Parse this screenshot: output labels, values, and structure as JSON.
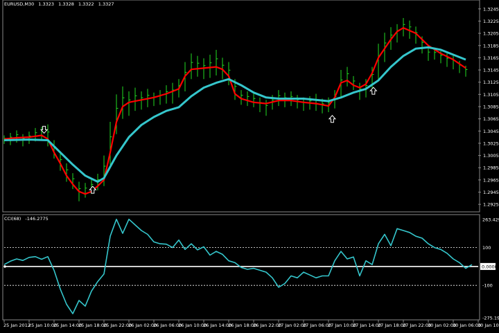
{
  "chart_data": [
    {
      "type": "line",
      "symbol": "EURUSD,M30",
      "quote": [
        "1.3323",
        "1.3328",
        "1.3322",
        "1.3327"
      ],
      "ylim": [
        1.2915,
        1.3255
      ],
      "y_ticks": [
        "1.3245",
        "1.3225",
        "1.3205",
        "1.3185",
        "1.3165",
        "1.3145",
        "1.3125",
        "1.3105",
        "1.3085",
        "1.3065",
        "1.3045",
        "1.3025",
        "1.3005",
        "1.2985",
        "1.2965",
        "1.2945",
        "1.2925"
      ],
      "x_ticks": [
        "25 Jan 2012",
        "25 Jan 10:00",
        "25 Jan 14:00",
        "25 Jan 18:00",
        "25 Jan 22:00",
        "26 Jan 02:00",
        "26 Jan 06:00",
        "26 Jan 10:00",
        "26 Jan 14:00",
        "26 Jan 18:00",
        "26 Jan 22:00",
        "27 Jan 02:00",
        "27 Jan 06:00",
        "27 Jan 10:00",
        "27 Jan 14:00",
        "27 Jan 18:00",
        "27 Jan 22:00",
        "30 Jan 02:00",
        "30 Jan 06:00",
        "30 Jan 10:00"
      ],
      "bars": [
        {
          "x": 0.0,
          "h": 1.3038,
          "l": 1.3024
        },
        {
          "x": 0.25,
          "h": 1.3042,
          "l": 1.3022
        },
        {
          "x": 0.5,
          "h": 1.3046,
          "l": 1.3026
        },
        {
          "x": 0.75,
          "h": 1.304,
          "l": 1.302
        },
        {
          "x": 1.0,
          "h": 1.3044,
          "l": 1.3024
        },
        {
          "x": 1.25,
          "h": 1.305,
          "l": 1.3028
        },
        {
          "x": 1.5,
          "h": 1.3052,
          "l": 1.303
        },
        {
          "x": 1.75,
          "h": 1.3056,
          "l": 1.302
        },
        {
          "x": 2.0,
          "h": 1.303,
          "l": 1.3
        },
        {
          "x": 2.25,
          "h": 1.3008,
          "l": 1.298
        },
        {
          "x": 2.5,
          "h": 1.2992,
          "l": 1.2962
        },
        {
          "x": 2.75,
          "h": 1.2976,
          "l": 1.295
        },
        {
          "x": 3.0,
          "h": 1.2962,
          "l": 1.293
        },
        {
          "x": 3.25,
          "h": 1.296,
          "l": 1.2936
        },
        {
          "x": 3.5,
          "h": 1.2966,
          "l": 1.2942
        },
        {
          "x": 3.75,
          "h": 1.2975,
          "l": 1.2948
        },
        {
          "x": 4.0,
          "h": 1.3005,
          "l": 1.2955
        },
        {
          "x": 4.25,
          "h": 1.306,
          "l": 1.299
        },
        {
          "x": 4.5,
          "h": 1.3105,
          "l": 1.304
        },
        {
          "x": 4.75,
          "h": 1.3118,
          "l": 1.3065
        },
        {
          "x": 5.0,
          "h": 1.311,
          "l": 1.307
        },
        {
          "x": 5.25,
          "h": 1.3116,
          "l": 1.3078
        },
        {
          "x": 5.5,
          "h": 1.311,
          "l": 1.308
        },
        {
          "x": 5.75,
          "h": 1.3114,
          "l": 1.3084
        },
        {
          "x": 6.0,
          "h": 1.3108,
          "l": 1.3086
        },
        {
          "x": 6.25,
          "h": 1.3112,
          "l": 1.3088
        },
        {
          "x": 6.5,
          "h": 1.312,
          "l": 1.309
        },
        {
          "x": 6.75,
          "h": 1.3124,
          "l": 1.309
        },
        {
          "x": 7.0,
          "h": 1.313,
          "l": 1.31
        },
        {
          "x": 7.25,
          "h": 1.3158,
          "l": 1.311
        },
        {
          "x": 7.5,
          "h": 1.3172,
          "l": 1.313
        },
        {
          "x": 7.75,
          "h": 1.3168,
          "l": 1.3134
        },
        {
          "x": 8.0,
          "h": 1.3164,
          "l": 1.313
        },
        {
          "x": 8.25,
          "h": 1.317,
          "l": 1.3132
        },
        {
          "x": 8.5,
          "h": 1.3178,
          "l": 1.3136
        },
        {
          "x": 8.75,
          "h": 1.3165,
          "l": 1.313
        },
        {
          "x": 9.0,
          "h": 1.3158,
          "l": 1.312
        },
        {
          "x": 9.25,
          "h": 1.313,
          "l": 1.3096
        },
        {
          "x": 9.5,
          "h": 1.3112,
          "l": 1.3088
        },
        {
          "x": 9.75,
          "h": 1.311,
          "l": 1.3086
        },
        {
          "x": 10.0,
          "h": 1.3106,
          "l": 1.3084
        },
        {
          "x": 10.25,
          "h": 1.31,
          "l": 1.3076
        },
        {
          "x": 10.5,
          "h": 1.3096,
          "l": 1.307
        },
        {
          "x": 10.75,
          "h": 1.3104,
          "l": 1.308
        },
        {
          "x": 11.0,
          "h": 1.3112,
          "l": 1.3086
        },
        {
          "x": 11.25,
          "h": 1.3108,
          "l": 1.3084
        },
        {
          "x": 11.5,
          "h": 1.311,
          "l": 1.3086
        },
        {
          "x": 11.75,
          "h": 1.3104,
          "l": 1.3082
        },
        {
          "x": 12.0,
          "h": 1.31,
          "l": 1.3078
        },
        {
          "x": 12.25,
          "h": 1.3102,
          "l": 1.308
        },
        {
          "x": 12.5,
          "h": 1.3106,
          "l": 1.3078
        },
        {
          "x": 12.75,
          "h": 1.3098,
          "l": 1.3074
        },
        {
          "x": 13.0,
          "h": 1.31,
          "l": 1.3076
        },
        {
          "x": 13.25,
          "h": 1.3112,
          "l": 1.3082
        },
        {
          "x": 13.5,
          "h": 1.3145,
          "l": 1.3098
        },
        {
          "x": 13.75,
          "h": 1.315,
          "l": 1.3118
        },
        {
          "x": 14.0,
          "h": 1.3135,
          "l": 1.3112
        },
        {
          "x": 14.25,
          "h": 1.3124,
          "l": 1.3096
        },
        {
          "x": 14.5,
          "h": 1.313,
          "l": 1.31
        },
        {
          "x": 14.75,
          "h": 1.315,
          "l": 1.3115
        },
        {
          "x": 15.0,
          "h": 1.3188,
          "l": 1.313
        },
        {
          "x": 15.25,
          "h": 1.3206,
          "l": 1.3158
        },
        {
          "x": 15.5,
          "h": 1.3215,
          "l": 1.3178
        },
        {
          "x": 15.75,
          "h": 1.322,
          "l": 1.319
        },
        {
          "x": 16.0,
          "h": 1.323,
          "l": 1.32
        },
        {
          "x": 16.25,
          "h": 1.3226,
          "l": 1.3196
        },
        {
          "x": 16.5,
          "h": 1.3216,
          "l": 1.3188
        },
        {
          "x": 16.75,
          "h": 1.32,
          "l": 1.3172
        },
        {
          "x": 17.0,
          "h": 1.3182,
          "l": 1.316
        },
        {
          "x": 17.25,
          "h": 1.318,
          "l": 1.3162
        },
        {
          "x": 17.5,
          "h": 1.3176,
          "l": 1.3156
        },
        {
          "x": 17.75,
          "h": 1.3172,
          "l": 1.315
        },
        {
          "x": 18.0,
          "h": 1.3168,
          "l": 1.3146
        },
        {
          "x": 18.25,
          "h": 1.316,
          "l": 1.314
        },
        {
          "x": 18.5,
          "h": 1.3152,
          "l": 1.3134
        }
      ],
      "series": [
        {
          "name": "",
          "color": "#ff0000",
          "points": [
            [
              0,
              1.3032
            ],
            [
              0.5,
              1.3034
            ],
            [
              1,
              1.3035
            ],
            [
              1.5,
              1.3038
            ],
            [
              1.75,
              1.3032
            ],
            [
              2,
              1.301
            ],
            [
              2.25,
              1.2992
            ],
            [
              2.5,
              1.2972
            ],
            [
              2.75,
              1.2958
            ],
            [
              3,
              1.2946
            ],
            [
              3.25,
              1.2942
            ],
            [
              3.5,
              1.2946
            ],
            [
              3.75,
              1.2955
            ],
            [
              4,
              1.2965
            ],
            [
              4.25,
              1.301
            ],
            [
              4.5,
              1.306
            ],
            [
              4.75,
              1.3085
            ],
            [
              5,
              1.3092
            ],
            [
              5.5,
              1.3096
            ],
            [
              6,
              1.31
            ],
            [
              6.5,
              1.3106
            ],
            [
              7,
              1.3114
            ],
            [
              7.25,
              1.3135
            ],
            [
              7.5,
              1.3146
            ],
            [
              8,
              1.3148
            ],
            [
              8.5,
              1.315
            ],
            [
              8.75,
              1.3146
            ],
            [
              9,
              1.3135
            ],
            [
              9.25,
              1.3106
            ],
            [
              9.5,
              1.3098
            ],
            [
              10,
              1.3092
            ],
            [
              10.5,
              1.309
            ],
            [
              11,
              1.3095
            ],
            [
              11.5,
              1.3095
            ],
            [
              12,
              1.3092
            ],
            [
              12.5,
              1.309
            ],
            [
              13,
              1.3086
            ],
            [
              13.25,
              1.31
            ],
            [
              13.5,
              1.3124
            ],
            [
              13.75,
              1.3128
            ],
            [
              14,
              1.312
            ],
            [
              14.25,
              1.3116
            ],
            [
              14.5,
              1.3122
            ],
            [
              14.75,
              1.314
            ],
            [
              15,
              1.3165
            ],
            [
              15.5,
              1.3195
            ],
            [
              15.75,
              1.3208
            ],
            [
              16,
              1.3214
            ],
            [
              16.5,
              1.3205
            ],
            [
              17,
              1.3185
            ],
            [
              17.5,
              1.3172
            ],
            [
              18,
              1.3162
            ],
            [
              18.5,
              1.3148
            ]
          ]
        },
        {
          "name": "",
          "color": "#35c6cc",
          "points": [
            [
              0,
              1.303
            ],
            [
              1,
              1.3031
            ],
            [
              1.75,
              1.303
            ],
            [
              2.25,
              1.301
            ],
            [
              2.75,
              1.299
            ],
            [
              3.25,
              1.2972
            ],
            [
              3.75,
              1.2962
            ],
            [
              4,
              1.2968
            ],
            [
              4.5,
              1.3005
            ],
            [
              5,
              1.3035
            ],
            [
              5.5,
              1.3055
            ],
            [
              6,
              1.3068
            ],
            [
              6.5,
              1.3078
            ],
            [
              7,
              1.3084
            ],
            [
              7.5,
              1.3102
            ],
            [
              8,
              1.3116
            ],
            [
              8.5,
              1.3124
            ],
            [
              9,
              1.313
            ],
            [
              9.5,
              1.312
            ],
            [
              10,
              1.3108
            ],
            [
              10.5,
              1.31
            ],
            [
              11,
              1.3098
            ],
            [
              11.5,
              1.3098
            ],
            [
              12,
              1.3098
            ],
            [
              12.5,
              1.3096
            ],
            [
              13,
              1.3094
            ],
            [
              13.5,
              1.31
            ],
            [
              14,
              1.3108
            ],
            [
              14.5,
              1.3114
            ],
            [
              15,
              1.3128
            ],
            [
              15.5,
              1.315
            ],
            [
              16,
              1.3168
            ],
            [
              16.5,
              1.318
            ],
            [
              17,
              1.3182
            ],
            [
              17.5,
              1.3178
            ],
            [
              18,
              1.317
            ],
            [
              18.5,
              1.3162
            ]
          ]
        }
      ],
      "arrows": [
        {
          "x": 1.6,
          "y": 1.3046,
          "dir": "down"
        },
        {
          "x": 3.55,
          "y": 1.295,
          "dir": "up"
        },
        {
          "x": 13.15,
          "y": 1.3066,
          "dir": "up"
        },
        {
          "x": 14.8,
          "y": 1.3112,
          "dir": "up"
        }
      ]
    },
    {
      "type": "line",
      "indicator": "CCI(68)",
      "value": "-146.2775",
      "ylim": [
        -275.197,
        263.429
      ],
      "y_ticks": [
        "263.429",
        "100",
        "0.0000",
        "-100",
        "-275.197"
      ],
      "levels": [
        100,
        -100
      ],
      "zero_label": "0.0000",
      "series": [
        {
          "name": "",
          "color": "#35c6cc",
          "points": [
            [
              0,
              10
            ],
            [
              0.25,
              28
            ],
            [
              0.5,
              40
            ],
            [
              0.75,
              32
            ],
            [
              1,
              48
            ],
            [
              1.25,
              52
            ],
            [
              1.5,
              38
            ],
            [
              1.75,
              52
            ],
            [
              2,
              -20
            ],
            [
              2.25,
              -120
            ],
            [
              2.5,
              -200
            ],
            [
              2.75,
              -250
            ],
            [
              3,
              -180
            ],
            [
              3.25,
              -210
            ],
            [
              3.5,
              -130
            ],
            [
              3.75,
              -80
            ],
            [
              4,
              -40
            ],
            [
              4.25,
              160
            ],
            [
              4.5,
              250
            ],
            [
              4.75,
              175
            ],
            [
              5,
              250
            ],
            [
              5.25,
              220
            ],
            [
              5.5,
              190
            ],
            [
              5.75,
              170
            ],
            [
              6,
              130
            ],
            [
              6.25,
              120
            ],
            [
              6.5,
              118
            ],
            [
              6.75,
              100
            ],
            [
              7,
              140
            ],
            [
              7.25,
              90
            ],
            [
              7.5,
              120
            ],
            [
              7.75,
              88
            ],
            [
              8,
              104
            ],
            [
              8.25,
              60
            ],
            [
              8.5,
              80
            ],
            [
              8.75,
              64
            ],
            [
              9,
              30
            ],
            [
              9.25,
              20
            ],
            [
              9.5,
              -5
            ],
            [
              9.75,
              -15
            ],
            [
              10,
              -10
            ],
            [
              10.25,
              -20
            ],
            [
              10.5,
              -30
            ],
            [
              10.75,
              -60
            ],
            [
              11,
              -110
            ],
            [
              11.25,
              -90
            ],
            [
              11.5,
              -50
            ],
            [
              11.75,
              -60
            ],
            [
              12,
              -30
            ],
            [
              12.25,
              -45
            ],
            [
              12.5,
              -60
            ],
            [
              12.75,
              -50
            ],
            [
              13,
              -50
            ],
            [
              13.25,
              30
            ],
            [
              13.5,
              80
            ],
            [
              13.75,
              40
            ],
            [
              14,
              50
            ],
            [
              14.25,
              -50
            ],
            [
              14.5,
              30
            ],
            [
              14.75,
              10
            ],
            [
              15,
              120
            ],
            [
              15.25,
              170
            ],
            [
              15.5,
              110
            ],
            [
              15.75,
              200
            ],
            [
              16,
              190
            ],
            [
              16.25,
              180
            ],
            [
              16.5,
              160
            ],
            [
              16.75,
              150
            ],
            [
              17,
              120
            ],
            [
              17.25,
              100
            ],
            [
              17.5,
              90
            ],
            [
              17.75,
              70
            ],
            [
              18,
              40
            ],
            [
              18.25,
              20
            ],
            [
              18.5,
              -10
            ],
            [
              18.75,
              10
            ]
          ]
        }
      ]
    }
  ],
  "colors": {
    "bars": "#22dd22",
    "grid": "#ffffff",
    "background": "#000000"
  }
}
